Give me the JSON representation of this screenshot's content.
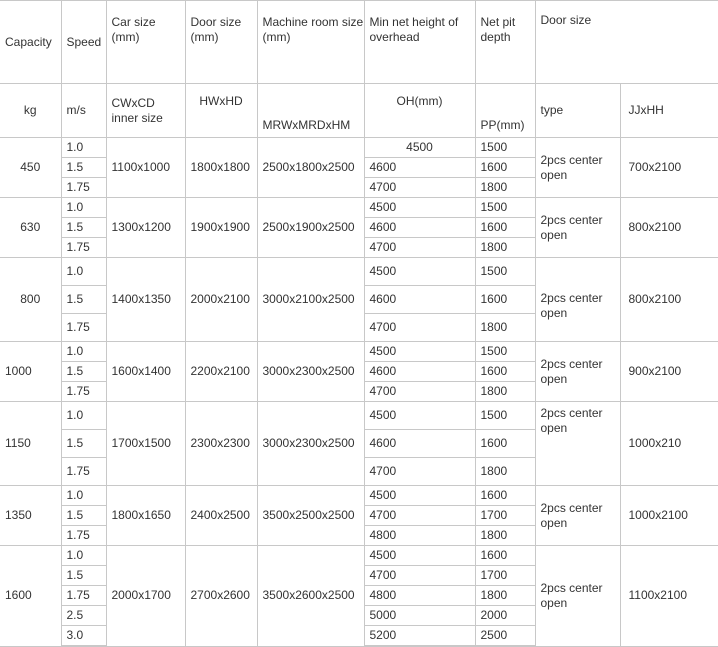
{
  "header": {
    "row1": {
      "capacity": "Capacity",
      "speed": "Speed",
      "car_size": "Car size (mm)",
      "door_size": "Door size (mm)",
      "machine_room": "Machine room size (mm)",
      "overhead": "Min net height of overhead",
      "pit": "Net pit depth",
      "door": "Door size"
    },
    "row2": {
      "capacity": "kg",
      "speed": "m/s",
      "car_size": "CWxCD inner size",
      "door_size": "HWxHD",
      "machine_room": "MRWxMRDxHM",
      "overhead": "OH(mm)",
      "pit": "PP(mm)",
      "door_type": "type",
      "door_dim": "JJxHH"
    }
  },
  "groups": [
    {
      "capacity": "450",
      "car": "1100x1000",
      "door": "1800x1800",
      "machine": "2500x1800x2500",
      "door_type": "2pcs center open",
      "door_dim": "700x2100",
      "rows": [
        {
          "speed": "1.0",
          "oh": "4500",
          "pp": "1500"
        },
        {
          "speed": "1.5",
          "oh": "4600",
          "pp": "1600"
        },
        {
          "speed": "1.75",
          "oh": "4700",
          "pp": "1800"
        }
      ]
    },
    {
      "capacity": "630",
      "car": "1300x1200",
      "door": "1900x1900",
      "machine": "2500x1900x2500",
      "door_type": "2pcs center open",
      "door_dim": "800x2100",
      "rows": [
        {
          "speed": "1.0",
          "oh": "4500",
          "pp": "1500"
        },
        {
          "speed": "1.5",
          "oh": "4600",
          "pp": "1600"
        },
        {
          "speed": "1.75",
          "oh": "4700",
          "pp": "1800"
        }
      ]
    },
    {
      "capacity": "800",
      "car": "1400x1350",
      "door": "2000x2100",
      "machine": "3000x2100x2500",
      "door_type": "2pcs center open",
      "door_dim": "800x2100",
      "rows": [
        {
          "speed": "1.0",
          "oh": "4500",
          "pp": "1500"
        },
        {
          "speed": "1.5",
          "oh": "4600",
          "pp": "1600"
        },
        {
          "speed": "1.75",
          "oh": "4700",
          "pp": "1800"
        }
      ]
    },
    {
      "capacity": "1000",
      "car": "1600x1400",
      "door": "2200x2100",
      "machine": "3000x2300x2500",
      "door_type": "2pcs center open",
      "door_dim": "900x2100",
      "rows": [
        {
          "speed": "1.0",
          "oh": "4500",
          "pp": "1500"
        },
        {
          "speed": "1.5",
          "oh": "4600",
          "pp": "1600"
        },
        {
          "speed": "1.75",
          "oh": "4700",
          "pp": "1800"
        }
      ]
    },
    {
      "capacity": "1150",
      "car": "1700x1500",
      "door": "2300x2300",
      "machine": "3000x2300x2500",
      "door_type": "2pcs center open",
      "door_dim": "1000x210",
      "rows": [
        {
          "speed": "1.0",
          "oh": "4500",
          "pp": "1500"
        },
        {
          "speed": "1.5",
          "oh": "4600",
          "pp": "1600"
        },
        {
          "speed": "1.75",
          "oh": "4700",
          "pp": "1800"
        }
      ]
    },
    {
      "capacity": "1350",
      "car": "1800x1650",
      "door": "2400x2500",
      "machine": "3500x2500x2500",
      "door_type": "2pcs center open",
      "door_dim": "1000x2100",
      "rows": [
        {
          "speed": "1.0",
          "oh": "4500",
          "pp": "1600"
        },
        {
          "speed": "1.5",
          "oh": "4700",
          "pp": "1700"
        },
        {
          "speed": "1.75",
          "oh": "4800",
          "pp": "1800"
        }
      ]
    },
    {
      "capacity": "1600",
      "car": "2000x1700",
      "door": "2700x2600",
      "machine": "3500x2600x2500",
      "door_type": "2pcs center open",
      "door_dim": "1100x2100",
      "rows": [
        {
          "speed": "1.0",
          "oh": "4500",
          "pp": "1600"
        },
        {
          "speed": "1.5",
          "oh": "4700",
          "pp": "1700"
        },
        {
          "speed": "1.75",
          "oh": "4800",
          "pp": "1800"
        },
        {
          "speed": "2.5",
          "oh": "5000",
          "pp": "2000"
        },
        {
          "speed": "3.0",
          "oh": "5200",
          "pp": "2500"
        }
      ]
    }
  ]
}
